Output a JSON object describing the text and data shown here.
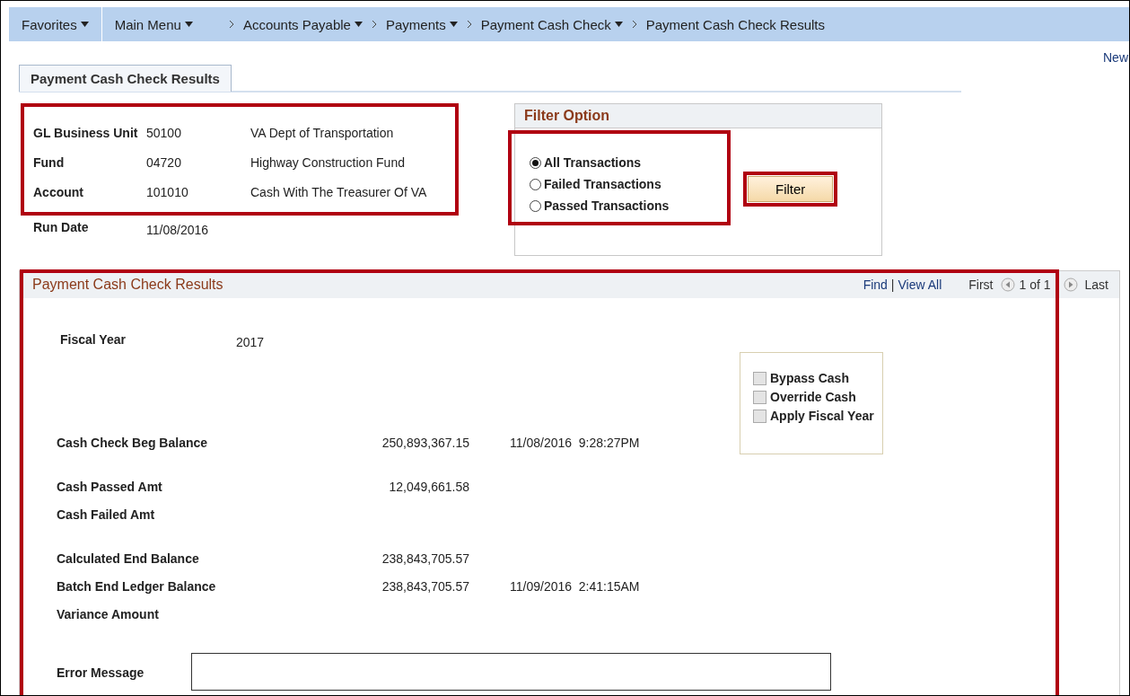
{
  "nav_bar": {
    "favorites": "Favorites",
    "main_menu": "Main Menu",
    "breadcrumbs": [
      {
        "label": "Accounts Payable",
        "dropdown": true
      },
      {
        "label": "Payments",
        "dropdown": true
      },
      {
        "label": "Payment Cash Check",
        "dropdown": true
      },
      {
        "label": "Payment Cash Check Results",
        "dropdown": false
      }
    ]
  },
  "new_window_link": "New",
  "tabs": [
    {
      "label": "Payment Cash Check Results",
      "selected": true
    }
  ],
  "info": {
    "highlighted": true,
    "rows": [
      {
        "label": "GL Business Unit",
        "value": "50100",
        "description": "VA Dept of Transportation"
      },
      {
        "label": "Fund",
        "value": "04720",
        "description": "Highway Construction Fund"
      },
      {
        "label": "Account",
        "value": "101010",
        "description": "Cash With The Treasurer Of VA"
      }
    ],
    "run_date": {
      "label": "Run Date",
      "value": "11/08/2016"
    }
  },
  "filter_option": {
    "title": "Filter Option",
    "highlighted": true,
    "options": [
      {
        "label": "All Transactions",
        "selected": true
      },
      {
        "label": "Failed Transactions",
        "selected": false
      },
      {
        "label": "Passed Transactions",
        "selected": false
      }
    ],
    "button": {
      "label": "Filter",
      "highlighted": true
    }
  },
  "results": {
    "title": "Payment Cash Check Results",
    "highlighted": true,
    "find": "Find",
    "separator": "|",
    "view_all": "View All",
    "first": "First",
    "count": "1 of 1",
    "last": "Last",
    "sections": [
      [
        {
          "kind": "year",
          "label": "Fiscal Year",
          "value": "2017"
        }
      ],
      [
        {
          "kind": "amount",
          "label": "Cash Check Beg Balance",
          "value": "250,893,367.15",
          "timestamp": "11/08/2016  9:28:27PM"
        }
      ],
      [
        {
          "kind": "amount",
          "label": "Cash Passed Amt",
          "value": "12,049,661.58"
        },
        {
          "kind": "amount",
          "label": "Cash Failed Amt"
        }
      ],
      [
        {
          "kind": "amount",
          "label": "Calculated End Balance",
          "value": "238,843,705.57"
        },
        {
          "kind": "amount",
          "label": "Batch End Ledger Balance",
          "value": "238,843,705.57",
          "timestamp": "11/09/2016  2:41:15AM"
        },
        {
          "kind": "amount",
          "label": "Variance Amount"
        }
      ],
      [
        {
          "kind": "field",
          "label": "Error Message"
        }
      ]
    ],
    "checkboxes": [
      {
        "label": "Bypass Cash",
        "checked": false
      },
      {
        "label": "Override Cash",
        "checked": false
      },
      {
        "label": "Apply Fiscal Year",
        "checked": false
      }
    ]
  }
}
